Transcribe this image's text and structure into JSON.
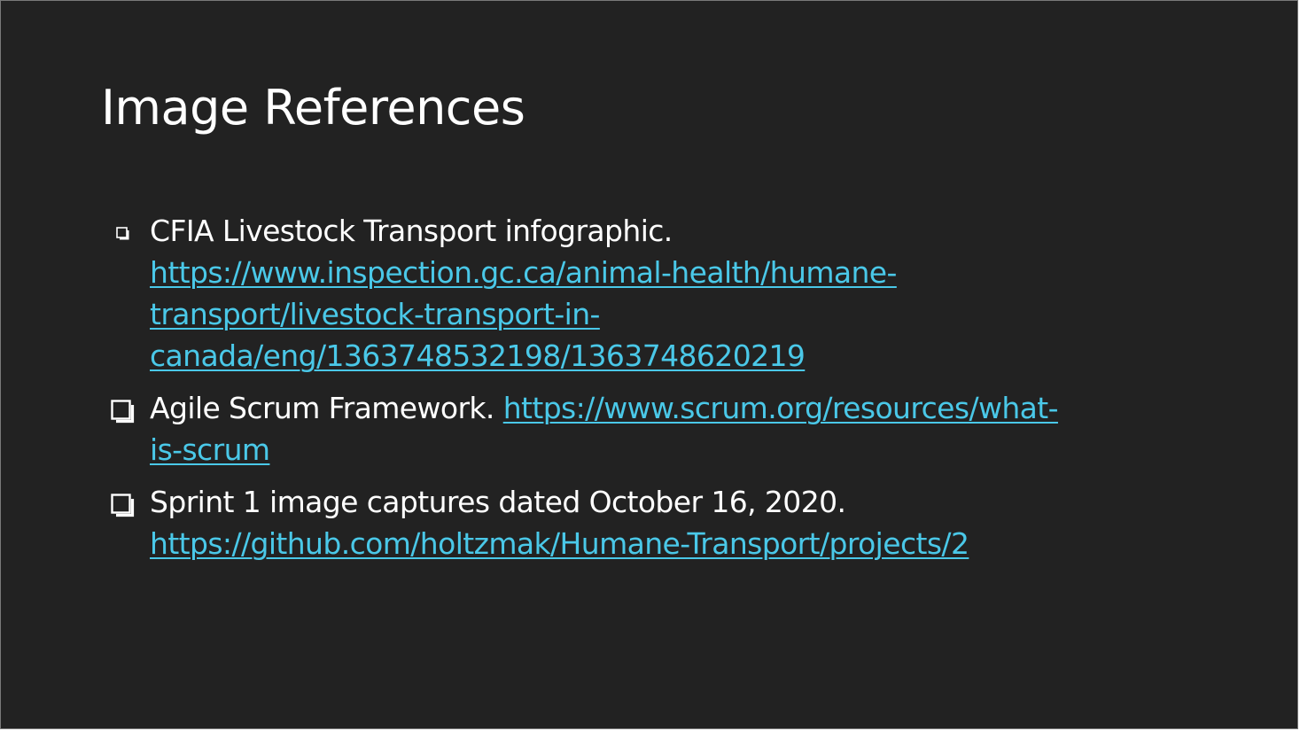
{
  "slide": {
    "title": "Image References",
    "references": [
      {
        "text": "CFIA Livestock Transport infographic.",
        "link_lines": [
          "https://www.inspection.gc.ca/animal-health/humane-",
          "transport/livestock-transport-in-",
          "canada/eng/1363748532198/1363748620219"
        ]
      },
      {
        "text": "Agile Scrum Framework.",
        "link_part1": "https://www.scrum.org/resources/what-",
        "link_part2": "is-scrum"
      },
      {
        "text": "Sprint 1 image captures dated October 16, 2020.",
        "link": "https://github.com/holtzmak/Humane-Transport/projects/2"
      }
    ]
  },
  "colors": {
    "background": "#222222",
    "text": "#ffffff",
    "link": "#4ac8e8"
  },
  "icons": {
    "bullet": "hollow-square-with-shadow-icon"
  }
}
